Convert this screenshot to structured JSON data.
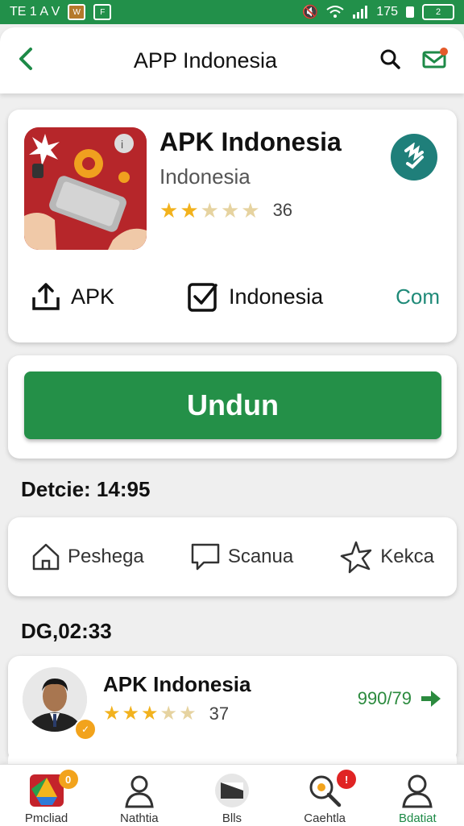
{
  "status_bar": {
    "left_text": "TE 1 A V",
    "icon_a": "W",
    "icon_b": "F",
    "time": "175",
    "battery": "2"
  },
  "app_bar": {
    "title": "APP Indonesia",
    "icons": [
      "back-icon",
      "search-icon",
      "mail-icon"
    ]
  },
  "app": {
    "name": "APK Indonesia",
    "developer": "Indonesia",
    "rating": 2.5,
    "rating_max": 5,
    "rating_count": "36",
    "meta": {
      "apk_label": "APK",
      "region_label": "Indonesia",
      "link_label": "Com"
    }
  },
  "install": {
    "label": "Undun"
  },
  "section_1": {
    "label": "Detcie: 14:95"
  },
  "tabs": [
    {
      "label": "Peshega",
      "icon": "home-icon"
    },
    {
      "label": "Scanua",
      "icon": "chat-icon"
    },
    {
      "label": "Kekca",
      "icon": "star-outline-icon"
    }
  ],
  "section_2": {
    "label": "DG,02:33"
  },
  "list_item": {
    "title": "APK Indonesia",
    "rating": 3.5,
    "rating_count": "37",
    "value": "990/79"
  },
  "bottom_nav": [
    {
      "label": "Pmcliad",
      "icon": "drive-icon",
      "badge": "0",
      "active": false
    },
    {
      "label": "Nathtia",
      "icon": "person-icon",
      "active": false
    },
    {
      "label": "Blls",
      "icon": "card-icon",
      "active": false
    },
    {
      "label": "Caehtla",
      "icon": "search-icon",
      "badge": "!",
      "active": false
    },
    {
      "label": "Bdatiat",
      "icon": "profile-icon",
      "active": true
    }
  ],
  "colors": {
    "primary": "#249048",
    "status_bar": "#22904a",
    "accent_teal": "#1f7f7a",
    "star": "#f2b21d",
    "badge_red": "#e02424",
    "badge_orange": "#f2a31c"
  }
}
